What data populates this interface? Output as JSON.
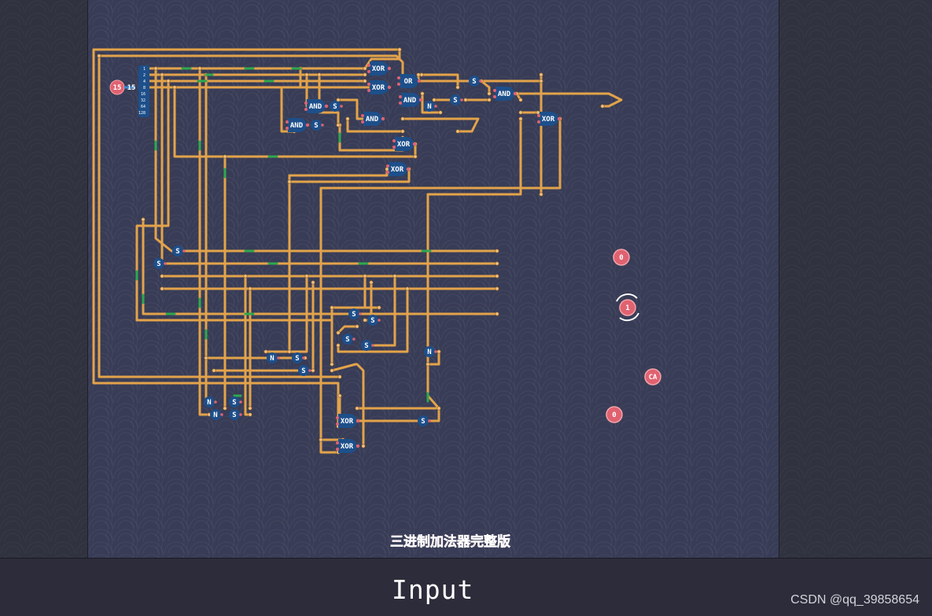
{
  "board": {
    "caption": "三进制加法器完整版"
  },
  "bottom_bar": {
    "mode_label": "Input",
    "watermark": "CSDN @qq_39858654"
  },
  "input_node": {
    "value": "15",
    "display": "15",
    "bit_labels": [
      "1",
      "2",
      "4",
      "8",
      "16",
      "32",
      "64",
      "128"
    ]
  },
  "gates": [
    {
      "kind": "XOR",
      "label": "XOR"
    },
    {
      "kind": "XOR",
      "label": "XOR"
    },
    {
      "kind": "OR",
      "label": "OR"
    },
    {
      "kind": "AND",
      "label": "AND"
    },
    {
      "kind": "AND",
      "label": "AND"
    },
    {
      "kind": "AND",
      "label": "AND"
    },
    {
      "kind": "AND",
      "label": "AND"
    },
    {
      "kind": "XOR",
      "label": "XOR"
    },
    {
      "kind": "XOR",
      "label": "XOR"
    },
    {
      "kind": "AND",
      "label": "AND"
    },
    {
      "kind": "XOR",
      "label": "XOR"
    },
    {
      "kind": "XOR",
      "label": "XOR"
    },
    {
      "kind": "XOR",
      "label": "XOR"
    }
  ],
  "small_nodes": [
    "S",
    "N"
  ],
  "output_nodes": [
    {
      "name": "output-1",
      "value": "0"
    },
    {
      "name": "output-2",
      "value": "1"
    },
    {
      "name": "output-3",
      "value": "CA"
    },
    {
      "name": "output-4",
      "value": "0"
    }
  ],
  "colors": {
    "wire": "#e3a34a",
    "wire_active": "#2fa84f",
    "gate": "#1d4f8a",
    "node_red": "#e06270",
    "caption": "#ff5b5b"
  }
}
